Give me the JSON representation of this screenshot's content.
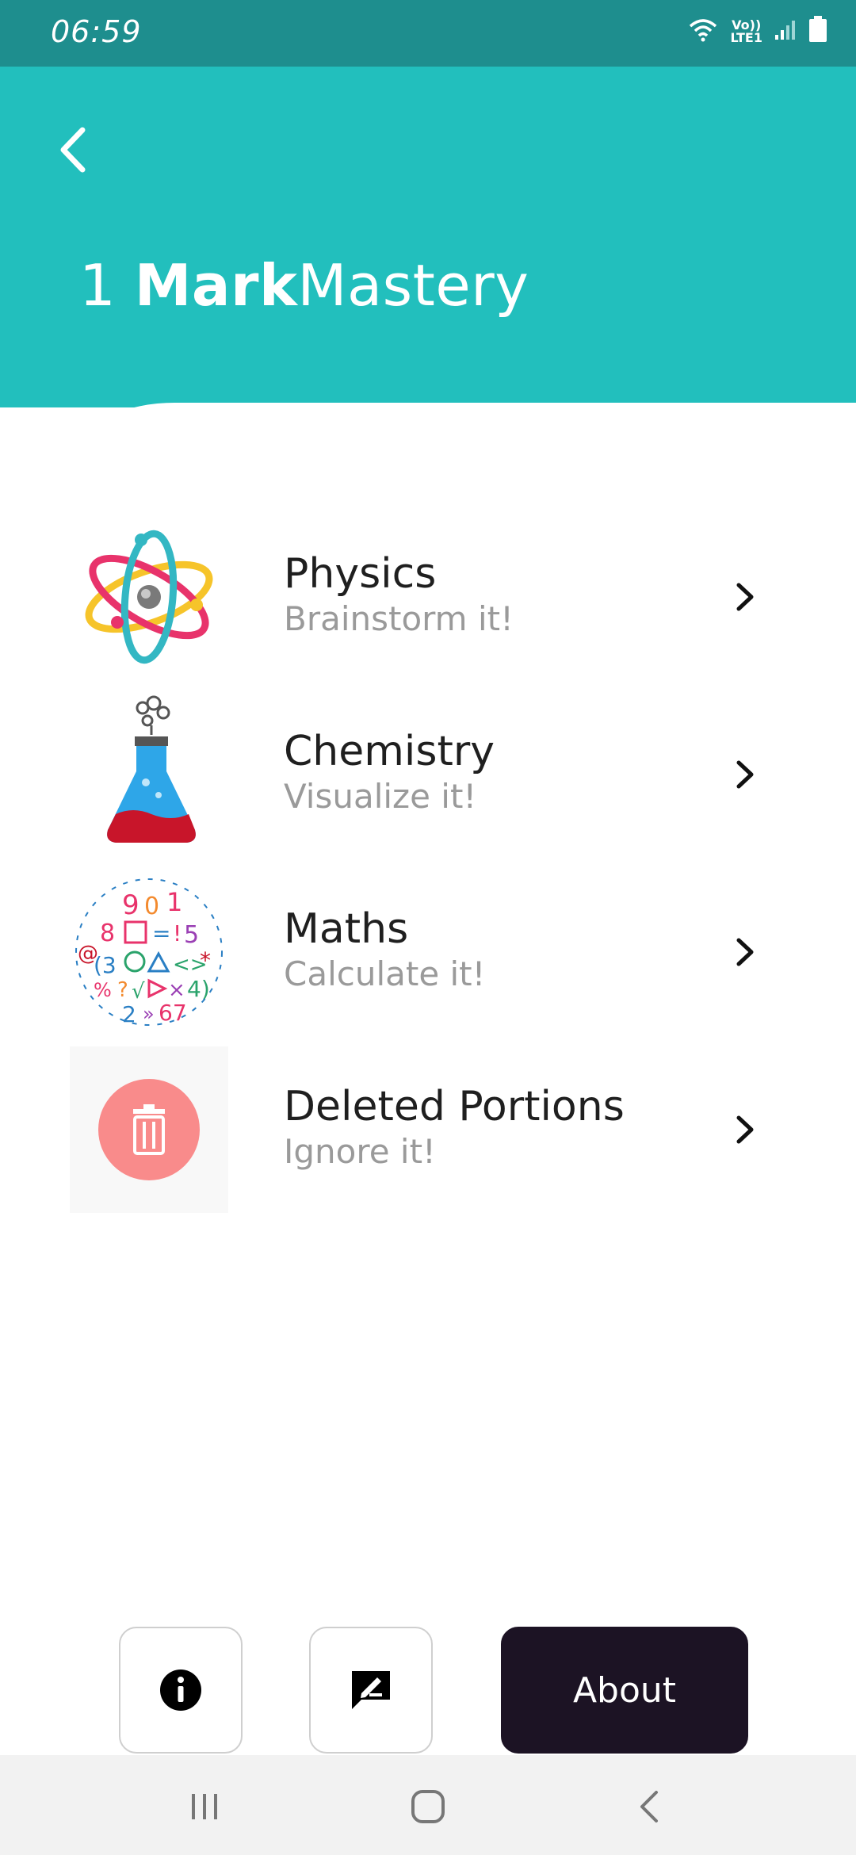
{
  "status_bar": {
    "time": "06:59",
    "network_label_top": "Vo))",
    "network_label_bottom": "LTE1",
    "icons": [
      "wifi-icon",
      "signal-icon",
      "battery-icon"
    ]
  },
  "header": {
    "back_icon": "back-arrow-icon",
    "title_number": "1 ",
    "title_bold": "Mark",
    "title_light": "Mastery",
    "color": "#22bfbd"
  },
  "subjects": [
    {
      "name": "Physics",
      "tagline": "Brainstorm it!",
      "icon": "atom-icon"
    },
    {
      "name": "Chemistry",
      "tagline": "Visualize it!",
      "icon": "flask-icon"
    },
    {
      "name": "Maths",
      "tagline": "Calculate it!",
      "icon": "math-symbols-icon"
    },
    {
      "name": "Deleted Portions",
      "tagline": "Ignore it!",
      "icon": "trash-icon"
    }
  ],
  "bottom_actions": {
    "info_icon": "info-icon",
    "feedback_icon": "feedback-icon",
    "about_label": "About"
  },
  "nav_bar": {
    "icons": [
      "recent-apps-icon",
      "home-icon",
      "back-icon"
    ]
  },
  "colors": {
    "accent": "#22bfbd",
    "status_bar": "#1e8e8e",
    "about_button": "#1c1324",
    "trash_circle": "#f98b8b"
  }
}
